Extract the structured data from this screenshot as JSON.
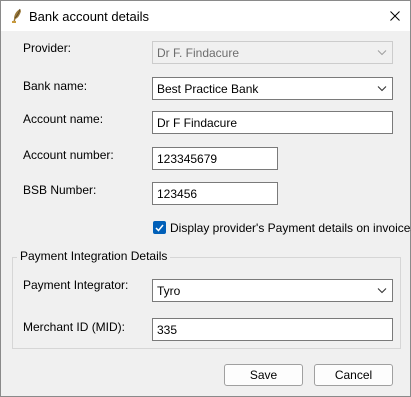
{
  "window": {
    "title": "Bank account details"
  },
  "form": {
    "provider_label": "Provider:",
    "provider_value": "Dr F. Findacure",
    "bank_name_label": "Bank name:",
    "bank_name_value": "Best Practice Bank",
    "account_name_label": "Account name:",
    "account_name_value": "Dr F Findacure",
    "account_number_label": "Account number:",
    "account_number_value": "123345679",
    "bsb_label": "BSB Number:",
    "bsb_value": "123456",
    "display_checkbox_label": "Display provider's Payment details on invoices",
    "display_checkbox_checked": true
  },
  "payment_integration": {
    "group_title": "Payment Integration Details",
    "integrator_label": "Payment Integrator:",
    "integrator_value": "Tyro",
    "merchant_label": "Merchant ID (MID):",
    "merchant_value": "335"
  },
  "buttons": {
    "save": "Save",
    "cancel": "Cancel"
  },
  "icons": {
    "app": "feather-quill-icon",
    "close": "close-icon",
    "combo_arrow": "chevron-down-icon",
    "checkmark": "checkmark-icon"
  },
  "colors": {
    "accent": "#005fb8",
    "dialog_bg": "#f0f0f0"
  }
}
